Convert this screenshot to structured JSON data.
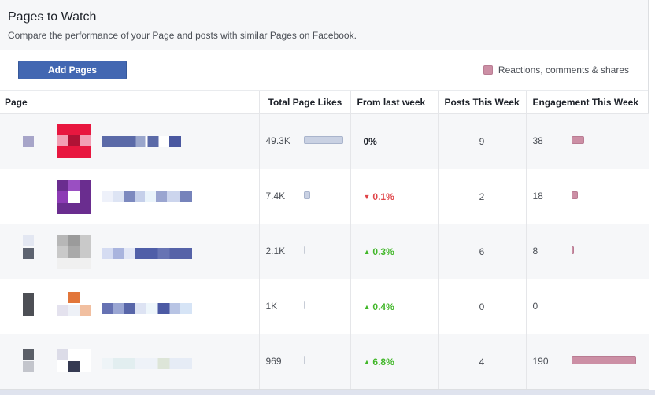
{
  "header": {
    "title": "Pages to Watch",
    "subtitle": "Compare the performance of your Page and posts with similar Pages on Facebook."
  },
  "toolbar": {
    "add_label": "Add Pages",
    "legend_label": "Reactions, comments & shares"
  },
  "table": {
    "columns": [
      "Page",
      "Total Page Likes",
      "From last week",
      "Posts This Week",
      "Engagement This Week"
    ],
    "rows": [
      {
        "likes": "49.3K",
        "likes_fraction": 1.0,
        "change": "0%",
        "direction": "none",
        "posts": "9",
        "engagement": "38",
        "eng_fraction": 0.2
      },
      {
        "likes": "7.4K",
        "likes_fraction": 0.15,
        "change": "0.1%",
        "direction": "down",
        "posts": "2",
        "engagement": "18",
        "eng_fraction": 0.095
      },
      {
        "likes": "2.1K",
        "likes_fraction": 0.04,
        "change": "0.3%",
        "direction": "up",
        "posts": "6",
        "engagement": "8",
        "eng_fraction": 0.04
      },
      {
        "likes": "1K",
        "likes_fraction": 0.02,
        "change": "0.4%",
        "direction": "up",
        "posts": "0",
        "engagement": "0",
        "eng_fraction": 0.0
      },
      {
        "likes": "969",
        "likes_fraction": 0.02,
        "change": "6.8%",
        "direction": "up",
        "posts": "4",
        "engagement": "190",
        "eng_fraction": 1.0
      }
    ]
  },
  "icons": {
    "down": "triangle-down-icon",
    "up": "triangle-up-icon"
  },
  "colors": {
    "button": "#4267b2",
    "engagement_bar": "#cc8fa5",
    "likes_bar": "#c9d1e3",
    "negative": "#e0464a",
    "positive": "#42b72a"
  }
}
